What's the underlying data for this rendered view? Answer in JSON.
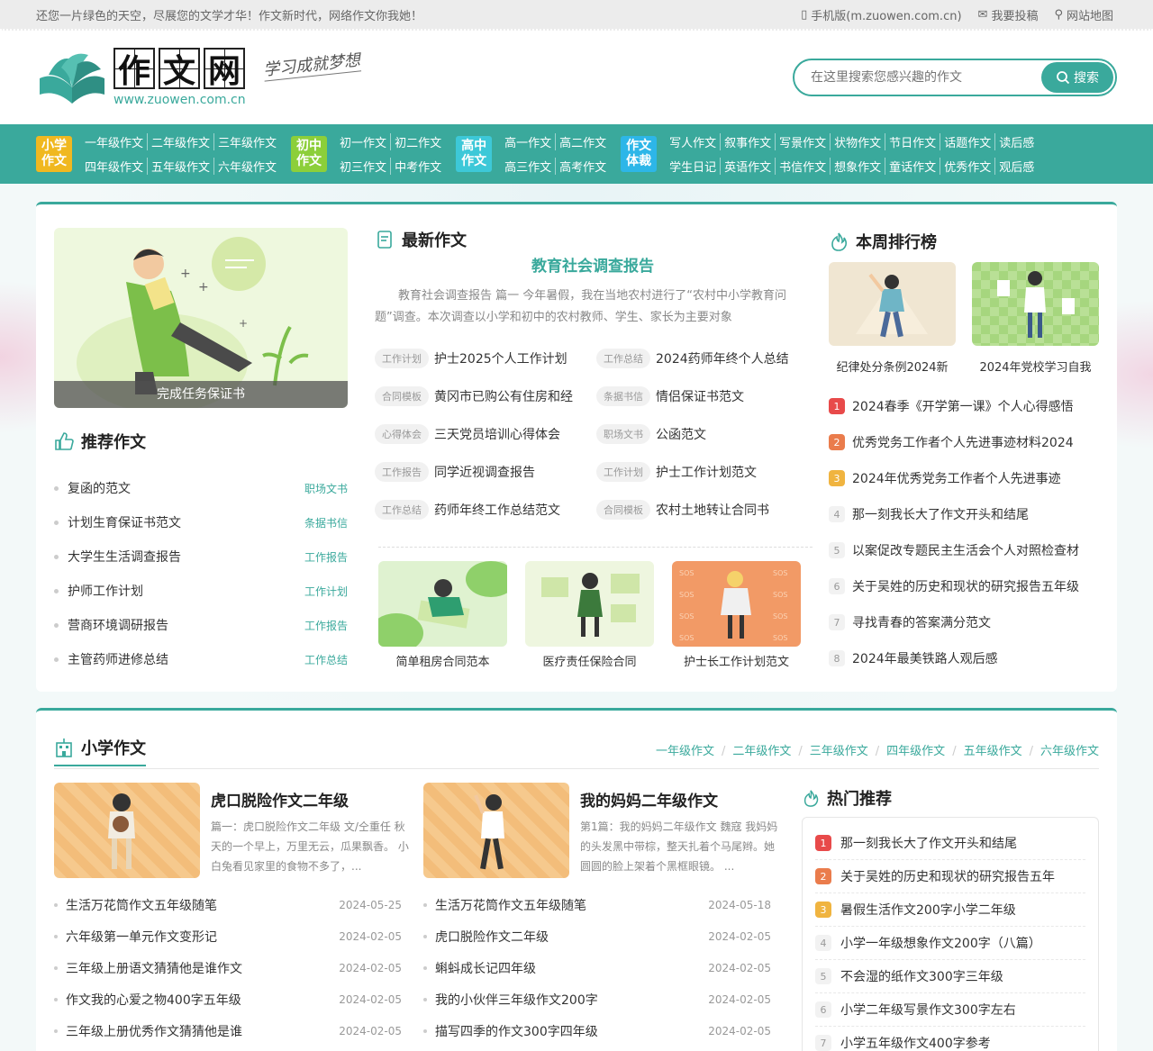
{
  "topbar": {
    "welcome": "还您一片绿色的天空，尽展您的文学才华！作文新时代，网络作文你我她！",
    "mobile": "手机版(m.zuowen.com.cn)",
    "submit": "我要投稿",
    "sitemap": "网站地图"
  },
  "logo": {
    "chars": [
      "作",
      "文",
      "网"
    ],
    "url": "www.zuowen.com.cn",
    "slogan": "学习成就梦想"
  },
  "search": {
    "placeholder": "在这里搜索您感兴趣的作文",
    "button": "搜索"
  },
  "nav": [
    {
      "tag": "小学作文",
      "color": "#f0b820",
      "rows": [
        [
          "一年级作文",
          "二年级作文",
          "三年级作文"
        ],
        [
          "四年级作文",
          "五年级作文",
          "六年级作文"
        ]
      ]
    },
    {
      "tag": "初中作文",
      "color": "#8ccf3a",
      "rows": [
        [
          "初一作文",
          "初二作文"
        ],
        [
          "初三作文",
          "中考作文"
        ]
      ]
    },
    {
      "tag": "高中作文",
      "color": "#3dc8d8",
      "rows": [
        [
          "高一作文",
          "高二作文"
        ],
        [
          "高三作文",
          "高考作文"
        ]
      ]
    },
    {
      "tag": "作文体裁",
      "color": "#2db6e8",
      "rows": [
        [
          "写人作文",
          "叙事作文",
          "写景作文",
          "状物作文",
          "节日作文",
          "话题作文",
          "读后感"
        ],
        [
          "学生日记",
          "英语作文",
          "书信作文",
          "想象作文",
          "童话作文",
          "优秀作文",
          "观后感"
        ]
      ]
    }
  ],
  "hero": {
    "caption": "完成任务保证书"
  },
  "recommend": {
    "title": "推荐作文",
    "items": [
      {
        "title": "复函的范文",
        "tag": "职场文书"
      },
      {
        "title": "计划生育保证书范文",
        "tag": "条据书信"
      },
      {
        "title": "大学生生活调查报告",
        "tag": "工作报告"
      },
      {
        "title": "护师工作计划",
        "tag": "工作计划"
      },
      {
        "title": "营商环境调研报告",
        "tag": "工作报告"
      },
      {
        "title": "主管药师进修总结",
        "tag": "工作总结"
      }
    ]
  },
  "latest": {
    "title": "最新作文",
    "featured_title": "教育社会调查报告",
    "featured_desc": "教育社会调查报告 篇一 今年暑假，我在当地农村进行了“农村中小学教育问题”调查。本次调查以小学和初中的农村教师、学生、家长为主要对象",
    "items": [
      {
        "tag": "工作计划",
        "title": "护士2025个人工作计划"
      },
      {
        "tag": "工作总结",
        "title": "2024药师年终个人总结"
      },
      {
        "tag": "合同模板",
        "title": "黄冈市已购公有住房和经"
      },
      {
        "tag": "条据书信",
        "title": "情侣保证书范文"
      },
      {
        "tag": "心得体会",
        "title": "三天党员培训心得体会"
      },
      {
        "tag": "职场文书",
        "title": "公函范文"
      },
      {
        "tag": "工作报告",
        "title": "同学近视调查报告"
      },
      {
        "tag": "工作计划",
        "title": "护士工作计划范文"
      },
      {
        "tag": "工作总结",
        "title": "药师年终工作总结范文"
      },
      {
        "tag": "合同模板",
        "title": "农村土地转让合同书"
      }
    ],
    "thumbs": [
      "简单租房合同范本",
      "医疗责任保险合同",
      "护士长工作计划范文"
    ]
  },
  "ranking": {
    "title": "本周排行榜",
    "thumbs": [
      "纪律处分条例2024新",
      "2024年党校学习自我"
    ],
    "items": [
      "2024春季《开学第一课》个人心得感悟",
      "优秀党务工作者个人先进事迹材料2024",
      "2024年优秀党务工作者个人先进事迹",
      "那一刻我长大了作文开头和结尾",
      "以案促改专题民主生活会个人对照检查材",
      "关于吴姓的历史和现状的研究报告五年级",
      "寻找青春的答案满分范文",
      "2024年最美铁路人观后感"
    ]
  },
  "primary": {
    "title": "小学作文",
    "tabs": [
      "一年级作文",
      "二年级作文",
      "三年级作文",
      "四年级作文",
      "五年级作文",
      "六年级作文"
    ],
    "articles": [
      {
        "title": "虎口脱险作文二年级",
        "desc": "篇一：虎口脱险作文二年级 文/仝重任 秋天的一个早上，万里无云，瓜果飘香。 小白兔看见家里的食物不多了，..."
      },
      {
        "title": "我的妈妈二年级作文",
        "desc": "第1篇：我的妈妈二年级作文 魏寇 我妈妈的头发黑中带棕，整天扎着个马尾辫。她圆圆的脸上架着个黑框眼镜。 ..."
      }
    ],
    "list_left": [
      {
        "title": "生活万花筒作文五年级随笔",
        "date": "2024-05-25"
      },
      {
        "title": "六年级第一单元作文变形记",
        "date": "2024-02-05"
      },
      {
        "title": "三年级上册语文猜猜他是谁作文",
        "date": "2024-02-05"
      },
      {
        "title": "作文我的心爱之物400字五年级",
        "date": "2024-02-05"
      },
      {
        "title": "三年级上册优秀作文猜猜他是谁",
        "date": "2024-02-05"
      }
    ],
    "list_right": [
      {
        "title": "生活万花筒作文五年级随笔",
        "date": "2024-05-18"
      },
      {
        "title": "虎口脱险作文二年级",
        "date": "2024-02-05"
      },
      {
        "title": "蝌蚪成长记四年级",
        "date": "2024-02-05"
      },
      {
        "title": "我的小伙伴三年级作文200字",
        "date": "2024-02-05"
      },
      {
        "title": "描写四季的作文300字四年级",
        "date": "2024-02-05"
      }
    ],
    "hot_title": "热门推荐",
    "hot": [
      "那一刻我长大了作文开头和结尾",
      "关于吴姓的历史和现状的研究报告五年",
      "暑假生活作文200字小学二年级",
      "小学一年级想象作文200字（八篇）",
      "不会湿的纸作文300字三年级",
      "小学二年级写景作文300字左右",
      "小学五年级作文400字参考"
    ]
  },
  "colors": {
    "accent": "#3aa99c",
    "rank1": "#e84a4a",
    "rank2": "#ea7c4c",
    "rank3": "#f0b440"
  }
}
